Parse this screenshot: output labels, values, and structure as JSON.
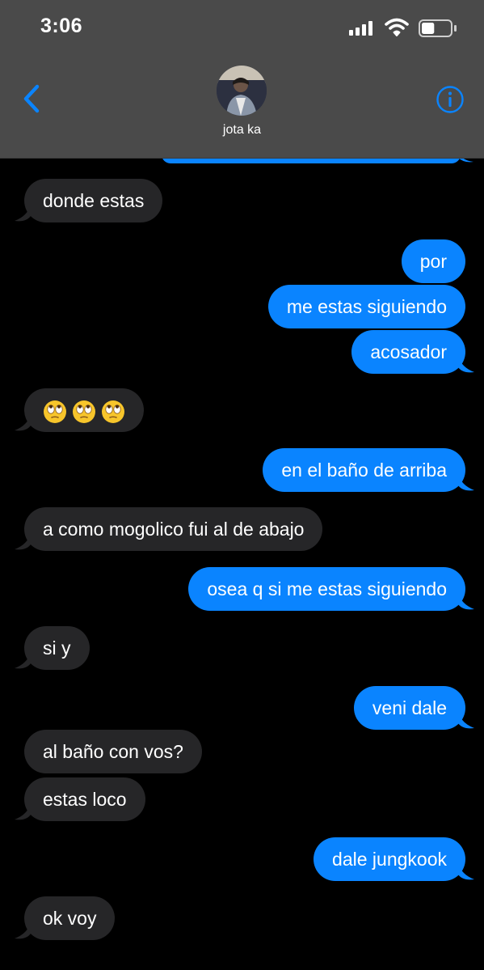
{
  "status_bar": {
    "time": "3:06",
    "battery_level": 0.45
  },
  "header": {
    "contact_name": "jota ka",
    "avatar_icon": "contact-photo"
  },
  "colors": {
    "header_bg": "#4a4a4a",
    "incoming_bubble": "#262628",
    "outgoing_bubble": "#0a84ff",
    "accent": "#0a84ff"
  },
  "messages": [
    {
      "direction": "in",
      "text": "donde estas"
    },
    {
      "direction": "out",
      "text": "por"
    },
    {
      "direction": "out",
      "text": "me estas siguiendo"
    },
    {
      "direction": "out",
      "text": "acosador"
    },
    {
      "direction": "in",
      "text": "",
      "emoji": [
        "face-with-rolling-eyes",
        "face-with-rolling-eyes",
        "face-with-rolling-eyes"
      ]
    },
    {
      "direction": "out",
      "text": "en el baño de arriba"
    },
    {
      "direction": "in",
      "text": "a como mogolico fui al de abajo"
    },
    {
      "direction": "out",
      "text": "osea q si me estas siguiendo"
    },
    {
      "direction": "in",
      "text": "si y"
    },
    {
      "direction": "out",
      "text": "veni dale"
    },
    {
      "direction": "in",
      "text": "al baño con vos?"
    },
    {
      "direction": "in",
      "text": "estas loco"
    },
    {
      "direction": "out",
      "text": "dale jungkook"
    },
    {
      "direction": "in",
      "text": "ok voy"
    }
  ]
}
